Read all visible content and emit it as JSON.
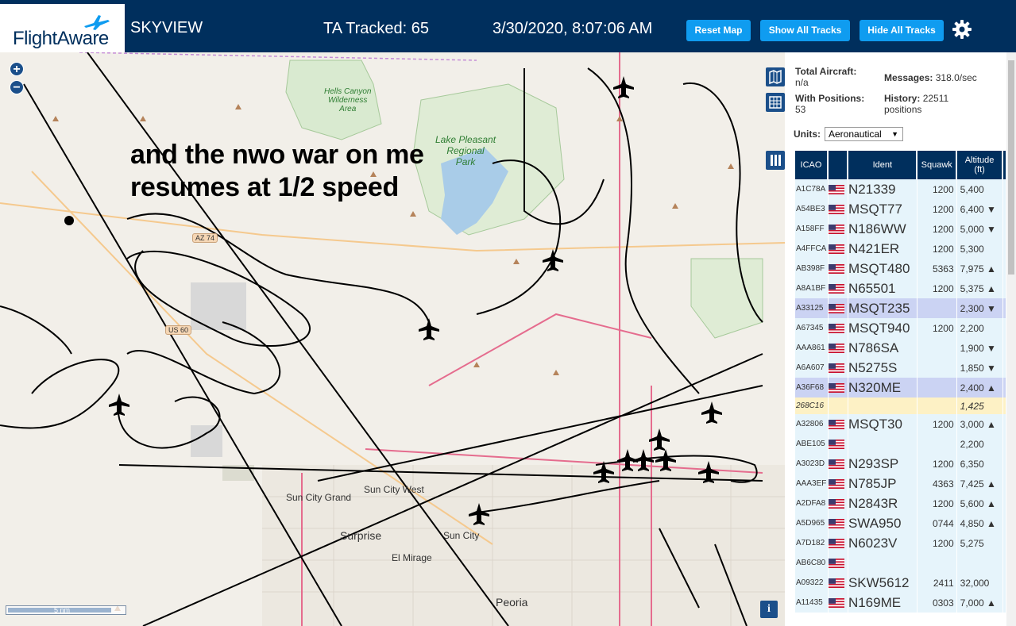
{
  "header": {
    "logo": "FlightAware",
    "app_title": "SKYVIEW",
    "ta_tracked": "TA Tracked: 65",
    "clock": "3/30/2020, 8:07:06 AM",
    "buttons": {
      "reset": "Reset Map",
      "show_all": "Show All Tracks",
      "hide_all": "Hide All Tracks"
    },
    "settings_icon": "gear-icon"
  },
  "map": {
    "overlay_text": "and the nwo war on me\nresumes at 1/2 speed",
    "places": [
      "Sun City Grand",
      "Sun City West",
      "Surprise",
      "Sun City",
      "El Mirage",
      "Peoria"
    ],
    "parks": {
      "hells_canyon": "Hells Canyon\nWilderness\nArea",
      "lake_pleasant": "Lake Pleasant\nRegional\nPark"
    },
    "shields": [
      "AZ 74",
      "US 60"
    ],
    "scale_label": "5 nm",
    "info": "i"
  },
  "sidebar": {
    "total_aircraft_label": "Total Aircraft:",
    "total_aircraft_value": "n/a",
    "with_positions_label": "With Positions:",
    "with_positions_value": "53",
    "messages_label": "Messages:",
    "messages_value": "318.0/sec",
    "history_label": "History:",
    "history_value": "22511",
    "history_unit": "positions",
    "units_label": "Units:",
    "units_value": "Aeronautical",
    "columns": {
      "icao": "ICAO",
      "ident": "Ident",
      "squawk": "Squawk",
      "altitude": "Altitude",
      "altitude_unit": "(ft)"
    },
    "rows": [
      {
        "icao": "A1C78A",
        "ident": "N21339",
        "squawk": "1200",
        "altitude": "5,400",
        "flag": true
      },
      {
        "icao": "A54BE3",
        "ident": "MSQT77",
        "squawk": "1200",
        "altitude": "6,400 ▼",
        "flag": true
      },
      {
        "icao": "A158FF",
        "ident": "N186WW",
        "squawk": "1200",
        "altitude": "5,000 ▼",
        "flag": true
      },
      {
        "icao": "A4FFCA",
        "ident": "N421ER",
        "squawk": "1200",
        "altitude": "5,300",
        "flag": true
      },
      {
        "icao": "AB398F",
        "ident": "MSQT480",
        "squawk": "5363",
        "altitude": "7,975 ▲",
        "flag": true
      },
      {
        "icao": "A8A1BF",
        "ident": "N65501",
        "squawk": "1200",
        "altitude": "5,375 ▲",
        "flag": true
      },
      {
        "icao": "A33125",
        "ident": "MSQT235",
        "squawk": "",
        "altitude": "2,300 ▼",
        "flag": true,
        "selected": true
      },
      {
        "icao": "A67345",
        "ident": "MSQT940",
        "squawk": "1200",
        "altitude": "2,200",
        "flag": true
      },
      {
        "icao": "AAA861",
        "ident": "N786SA",
        "squawk": "",
        "altitude": "1,900 ▼",
        "flag": true
      },
      {
        "icao": "A6A607",
        "ident": "N5275S",
        "squawk": "",
        "altitude": "1,850 ▼",
        "flag": true
      },
      {
        "icao": "A36F68",
        "ident": "N320ME",
        "squawk": "",
        "altitude": "2,400 ▲",
        "flag": true,
        "selected": true
      },
      {
        "icao": "268C16",
        "ident": "",
        "squawk": "",
        "altitude": "1,425",
        "flag": false,
        "mlat": true
      },
      {
        "icao": "A32806",
        "ident": "MSQT30",
        "squawk": "1200",
        "altitude": "3,000 ▲",
        "flag": true
      },
      {
        "icao": "ABE105",
        "ident": "",
        "squawk": "",
        "altitude": "2,200",
        "flag": true
      },
      {
        "icao": "A3023D",
        "ident": "N293SP",
        "squawk": "1200",
        "altitude": "6,350",
        "flag": true
      },
      {
        "icao": "AAA3EF",
        "ident": "N785JP",
        "squawk": "4363",
        "altitude": "7,425 ▲",
        "flag": true
      },
      {
        "icao": "A2DFA8",
        "ident": "N2843R",
        "squawk": "1200",
        "altitude": "5,600 ▲",
        "flag": true
      },
      {
        "icao": "A5D965",
        "ident": "SWA950",
        "squawk": "0744",
        "altitude": "4,850 ▲",
        "flag": true
      },
      {
        "icao": "A7D182",
        "ident": "N6023V",
        "squawk": "1200",
        "altitude": "5,275",
        "flag": true
      },
      {
        "icao": "AB6C80",
        "ident": "",
        "squawk": "",
        "altitude": "",
        "flag": true
      },
      {
        "icao": "A09322",
        "ident": "SKW5612",
        "squawk": "2411",
        "altitude": "32,000",
        "flag": true
      },
      {
        "icao": "A11435",
        "ident": "N169ME",
        "squawk": "0303",
        "altitude": "7,000 ▲",
        "flag": true
      }
    ]
  }
}
